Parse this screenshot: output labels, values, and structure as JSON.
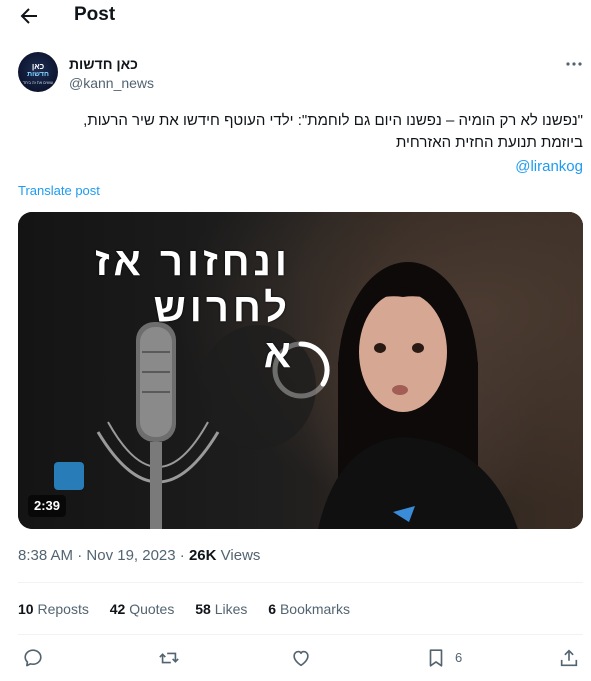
{
  "header": {
    "title": "Post"
  },
  "author": {
    "display_name": "כאן חדשות",
    "handle": "@kann_news",
    "avatar_lines": [
      "כאן",
      "חדשות",
      "עושים את זה ביחד"
    ]
  },
  "post": {
    "text_lines": [
      "\"נפשנו לא רק הומיה – נפשנו היום גם לוחמת\": ילדי העוטף חידשו את שיר הרעות,",
      "ביוזמת תנועת החזית האזרחית"
    ],
    "mention": "@lirankog",
    "translate_label": "Translate post"
  },
  "media": {
    "overlay_lines": [
      "ונחזור אז",
      "לחרוש",
      "א"
    ],
    "duration": "2:39"
  },
  "meta": {
    "time": "8:38 AM",
    "separator": "·",
    "date": "Nov 19, 2023",
    "views_count": "26K",
    "views_label": "Views"
  },
  "stats": [
    {
      "count": "10",
      "label": "Reposts"
    },
    {
      "count": "42",
      "label": "Quotes"
    },
    {
      "count": "58",
      "label": "Likes"
    },
    {
      "count": "6",
      "label": "Bookmarks"
    }
  ],
  "actions": {
    "bookmark_count": "6",
    "icons": [
      "reply-icon",
      "repost-icon",
      "like-icon",
      "bookmark-icon",
      "share-icon"
    ]
  },
  "colors": {
    "accent": "#1d9bf0",
    "text_primary": "#0f1419",
    "text_secondary": "#536471",
    "divider": "#eff3f4"
  }
}
